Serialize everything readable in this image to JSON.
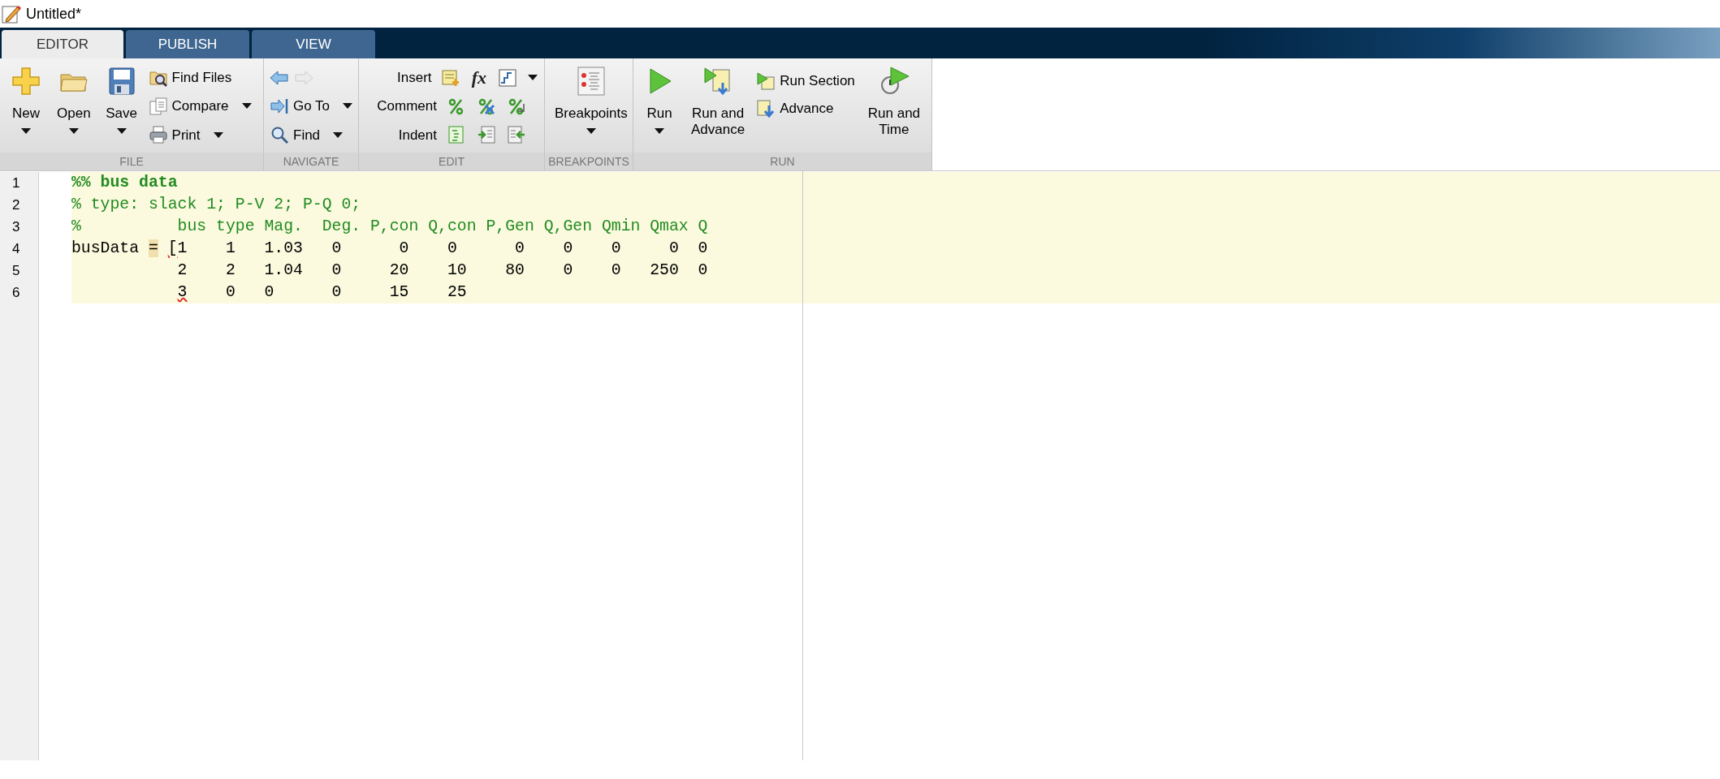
{
  "window": {
    "title": "Untitled*"
  },
  "tabs": [
    {
      "label": "EDITOR",
      "selected": true
    },
    {
      "label": "PUBLISH",
      "selected": false
    },
    {
      "label": "VIEW",
      "selected": false
    }
  ],
  "toolstrip": {
    "groups": [
      {
        "label": "FILE",
        "items": [
          {
            "kind": "large",
            "label": "New",
            "dropdown": true
          },
          {
            "kind": "large",
            "label": "Open",
            "dropdown": true
          },
          {
            "kind": "large",
            "label": "Save",
            "dropdown": true
          },
          {
            "kind": "stack",
            "entries": [
              {
                "label": "Find Files",
                "dropdown": false
              },
              {
                "label": "Compare",
                "dropdown": true
              },
              {
                "label": "Print",
                "dropdown": true
              }
            ]
          }
        ]
      },
      {
        "label": "NAVIGATE",
        "items": [
          {
            "kind": "stack",
            "entries": [
              {
                "kind": "arrows",
                "forward_disabled": true
              },
              {
                "label": "Go To",
                "dropdown": true
              },
              {
                "label": "Find",
                "dropdown": true
              }
            ]
          }
        ]
      },
      {
        "label": "EDIT",
        "items": [
          {
            "kind": "rows",
            "entries": [
              {
                "label": "Insert",
                "symbol": "fx",
                "dropdown": true
              },
              {
                "label": "Comment",
                "dropdown": false
              },
              {
                "label": "Indent",
                "dropdown": false
              }
            ]
          }
        ]
      },
      {
        "label": "BREAKPOINTS",
        "items": [
          {
            "kind": "large",
            "label": "Breakpoints",
            "dropdown": true
          }
        ]
      },
      {
        "label": "RUN",
        "items": [
          {
            "kind": "large",
            "label": "Run",
            "dropdown": true
          },
          {
            "kind": "large",
            "label": "Run and Advance",
            "dropdown": false
          },
          {
            "kind": "stack",
            "entries": [
              {
                "label": "Run Section",
                "dropdown": false
              },
              {
                "label": "Advance",
                "dropdown": false
              }
            ]
          },
          {
            "kind": "large",
            "label": "Run and Time",
            "dropdown": false
          }
        ]
      }
    ]
  },
  "editor": {
    "lines": [
      {
        "number": "1",
        "current_section": true,
        "segments": [
          {
            "text": "%% bus data",
            "kind": "section"
          }
        ]
      },
      {
        "number": "2",
        "current_section": true,
        "segments": [
          {
            "text": "% type: slack 1; P-V 2; P-Q 0;",
            "kind": "comment"
          }
        ]
      },
      {
        "number": "3",
        "current_section": true,
        "segments": [
          {
            "text": "%          bus type Mag.  Deg. P,con Q,con P,Gen Q,Gen Qmin Qmax Q",
            "kind": "comment"
          }
        ]
      },
      {
        "number": "4",
        "current_section": true,
        "segments": [
          {
            "text": "busData ",
            "kind": "code"
          },
          {
            "text": "=",
            "kind": "match"
          },
          {
            "text": " [",
            "kind": "warning"
          },
          {
            "text": "1    1   1.03   0      0    0      0    0    0     0  0",
            "kind": "code"
          }
        ]
      },
      {
        "number": "5",
        "current_section": true,
        "segments": [
          {
            "text": "           2    2   1.04   0     20    10    80    0    0   250  0",
            "kind": "code"
          }
        ]
      },
      {
        "number": "6",
        "current_section": true,
        "segments": [
          {
            "text": "           3",
            "kind": "warning"
          },
          {
            "text": "    0   0      0     15    25",
            "kind": "code"
          }
        ]
      }
    ]
  }
}
